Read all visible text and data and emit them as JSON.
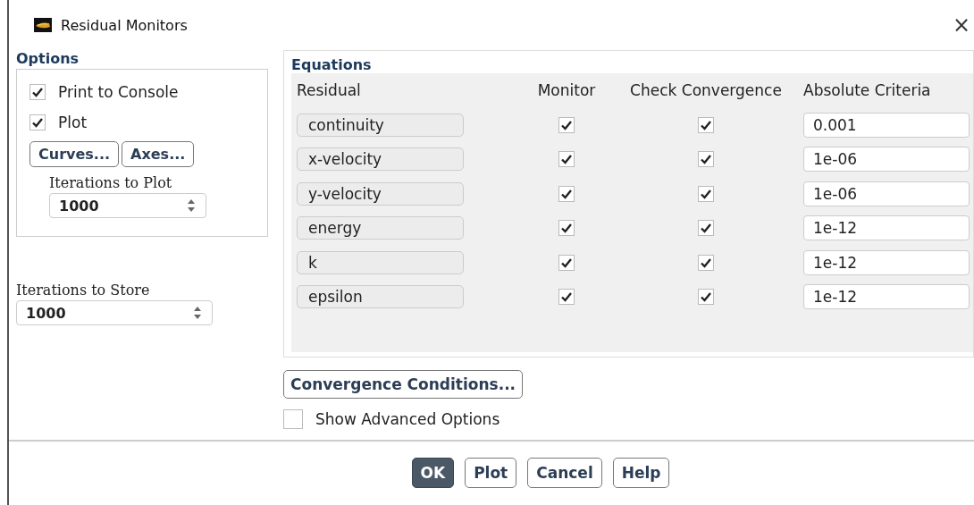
{
  "window": {
    "title": "Residual Monitors",
    "close": "×"
  },
  "options": {
    "title": "Options",
    "checkboxes": [
      {
        "label": "Print to Console",
        "checked": true
      },
      {
        "label": "Plot",
        "checked": true
      }
    ],
    "buttons": [
      "Curves...",
      "Axes..."
    ],
    "iterations_to_plot": {
      "label": "Iterations to Plot",
      "value": "1000"
    }
  },
  "iterations_to_store": {
    "label": "Iterations to Store",
    "value": "1000"
  },
  "equations": {
    "title": "Equations",
    "columns": [
      "Residual",
      "Monitor",
      "Check Convergence",
      "Absolute Criteria"
    ],
    "rows": [
      {
        "residual": "continuity",
        "monitor": true,
        "check_convergence": true,
        "criteria": "0.001"
      },
      {
        "residual": "x-velocity",
        "monitor": true,
        "check_convergence": true,
        "criteria": "1e-06"
      },
      {
        "residual": "y-velocity",
        "monitor": true,
        "check_convergence": true,
        "criteria": "1e-06"
      },
      {
        "residual": "energy",
        "monitor": true,
        "check_convergence": true,
        "criteria": "1e-12"
      },
      {
        "residual": "k",
        "monitor": true,
        "check_convergence": true,
        "criteria": "1e-12"
      },
      {
        "residual": "epsilon",
        "monitor": true,
        "check_convergence": true,
        "criteria": "1e-12"
      }
    ]
  },
  "convergence_conditions": "Convergence Conditions...",
  "show_advanced": {
    "label": "Show Advanced Options",
    "checked": false
  },
  "buttons": [
    {
      "label": "OK",
      "kind": "default"
    },
    {
      "label": "Plot",
      "kind": "normal"
    },
    {
      "label": "Cancel",
      "kind": "normal"
    },
    {
      "label": "Help",
      "kind": "normal"
    }
  ]
}
